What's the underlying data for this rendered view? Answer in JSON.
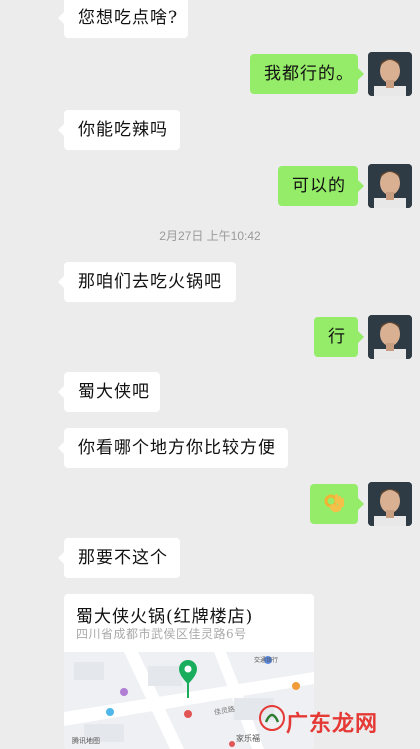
{
  "messages": [
    {
      "side": "in",
      "text": "您想吃点啥?"
    },
    {
      "side": "out",
      "text": "我都行的。"
    },
    {
      "side": "in",
      "text": "你能吃辣吗"
    },
    {
      "side": "out",
      "text": "可以的"
    },
    {
      "side": "in",
      "text": "那咱们去吃火锅吧"
    },
    {
      "side": "out",
      "text": "行"
    },
    {
      "side": "in",
      "text": "蜀大侠吧"
    },
    {
      "side": "in",
      "text": "你看哪个地方你比较方便"
    },
    {
      "side": "out",
      "text": "",
      "emoji": "ok-hand-emoji"
    },
    {
      "side": "in",
      "text": "那要不这个"
    }
  ],
  "timestamp": "2月27日 上午10:42",
  "location_card": {
    "title": "蜀大侠火锅(红牌楼店)",
    "address": "四川省成都市武侯区佳灵路6号",
    "map_labels": {
      "bank": "交通银行",
      "street": "佳灵路",
      "home": "家乐福",
      "provider": "腾讯地图"
    }
  },
  "watermark": "广东龙网",
  "colors": {
    "background": "#ececec",
    "incoming": "#ffffff",
    "outgoing": "#95ec69",
    "map_pin": "#1aad5d",
    "watermark": "#e53935"
  }
}
